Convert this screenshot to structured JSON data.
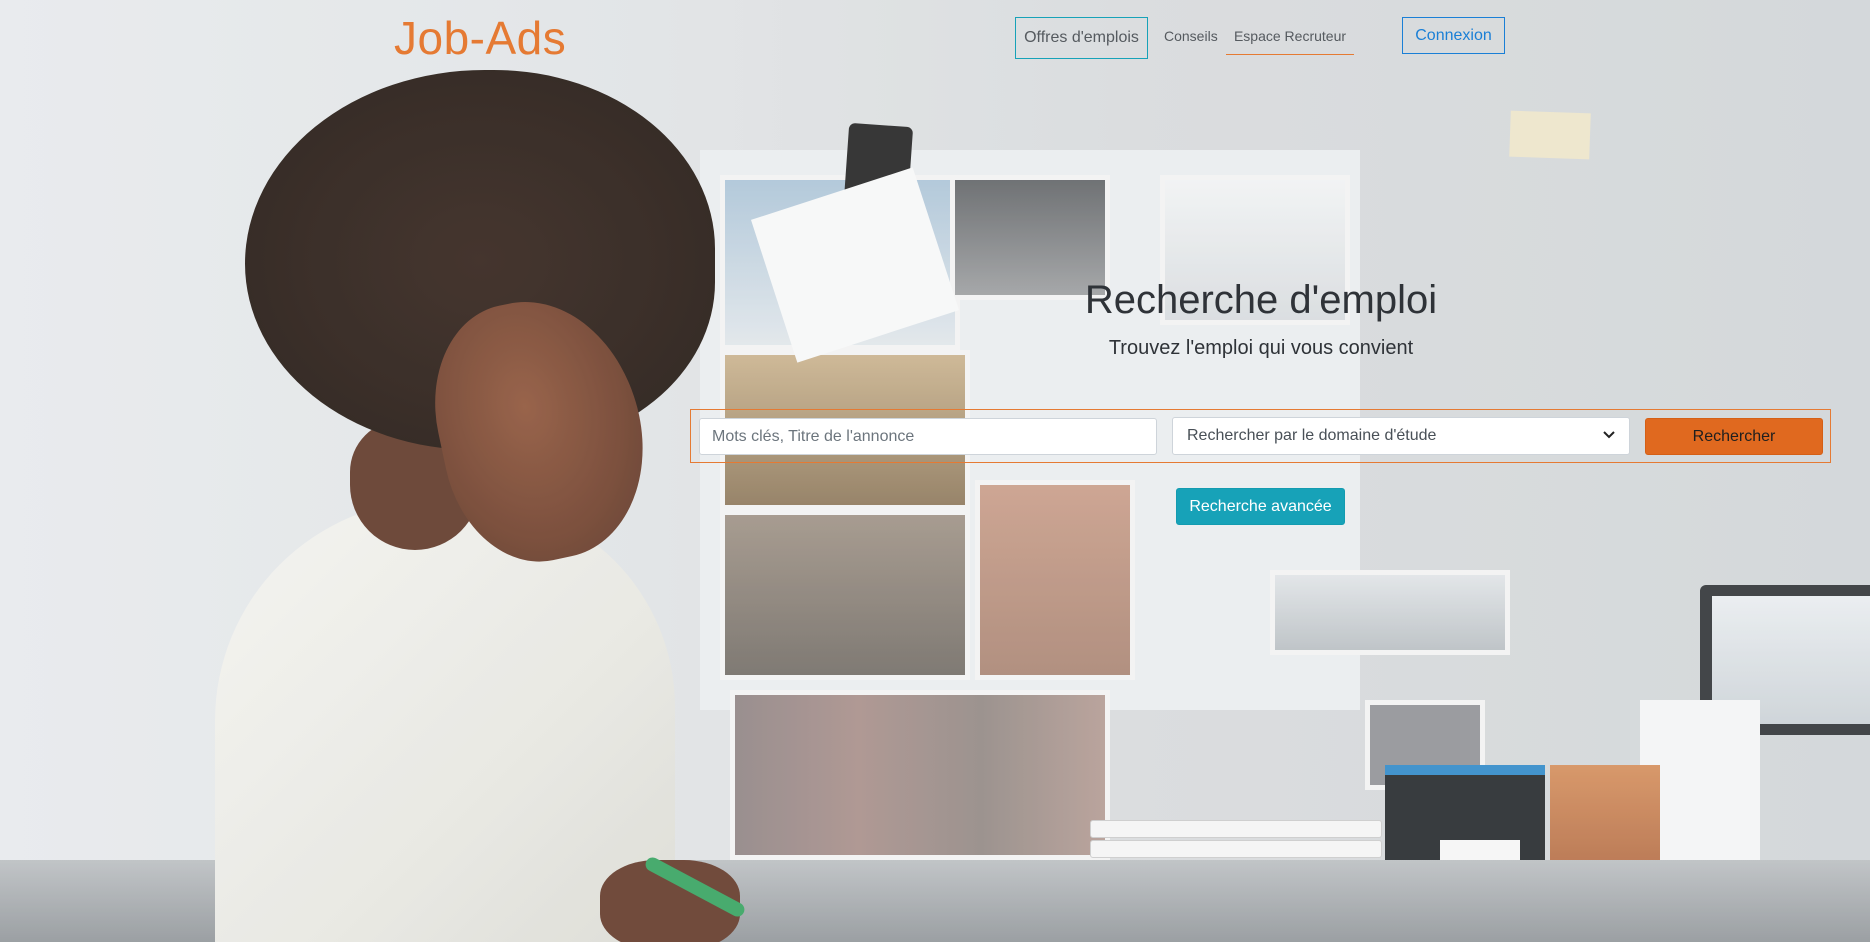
{
  "header": {
    "logo": "Job-Ads",
    "nav": {
      "offres": "Offres d'emplois",
      "conseils": "Conseils",
      "recruteur": "Espace Recruteur"
    },
    "login_label": "Connexion"
  },
  "hero": {
    "title": "Recherche d'emploi",
    "subtitle": "Trouvez l'emploi qui vous convient"
  },
  "search": {
    "placeholder": "Mots clés, Titre de l'annonce",
    "domain_selected": "Rechercher par le domaine d'étude",
    "submit_label": "Rechercher",
    "advanced_label": "Recherche avancée"
  },
  "icons": {
    "select_chevron": "chevron-down-icon"
  },
  "colors": {
    "brand": "#e57a33",
    "accent_teal": "#17a2b8",
    "link_blue": "#1a7fd6",
    "search_button": "#e0691f"
  }
}
